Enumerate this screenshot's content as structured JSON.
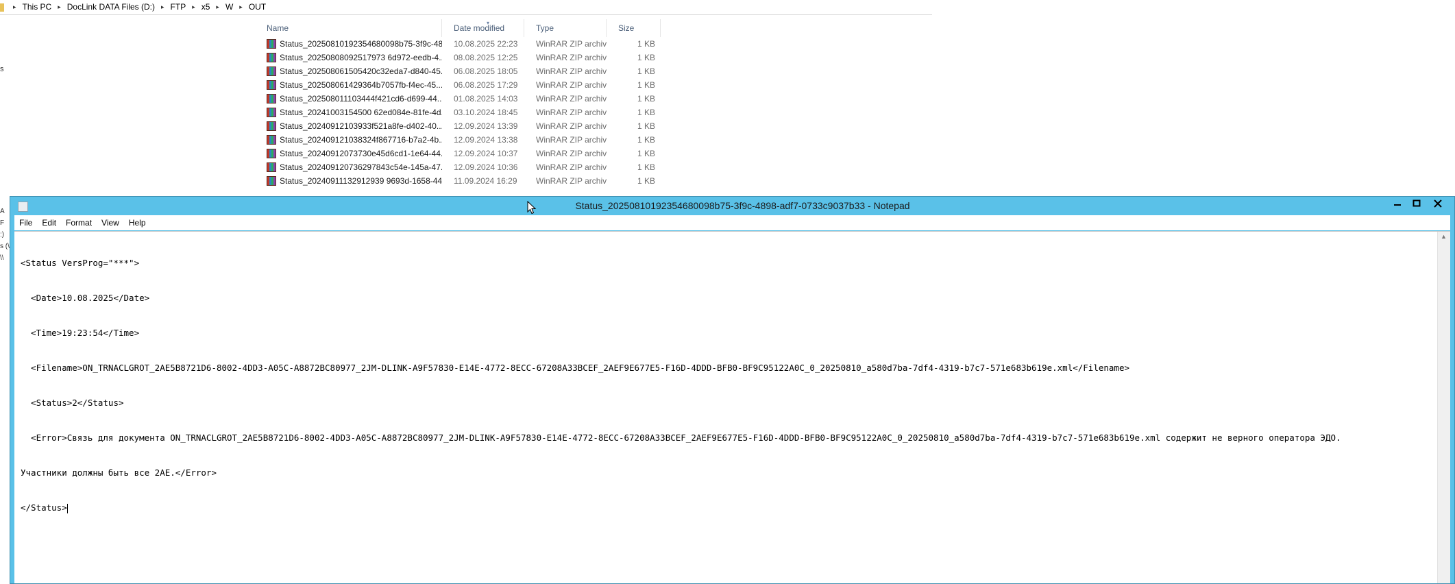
{
  "explorer": {
    "breadcrumb": [
      "This PC",
      "DocLink DATA Files (D:)",
      "FTP",
      "x5",
      "W",
      "OUT"
    ],
    "left_stub_text": "s",
    "left_stub_lines": [
      "A F",
      ":)",
      "s (\\",
      "\\\\"
    ],
    "columns": {
      "name": "Name",
      "date": "Date modified",
      "type": "Type",
      "size": "Size"
    },
    "files": [
      {
        "name": "Status_20250810192354680098b75-3f9c-48...",
        "date": "10.08.2025 22:23",
        "type": "WinRAR ZIP archive",
        "size": "1 KB"
      },
      {
        "name": "Status_20250808092517973 6d972-eedb-4...",
        "date": "08.08.2025 12:25",
        "type": "WinRAR ZIP archive",
        "size": "1 KB"
      },
      {
        "name": "Status_202508061505420c32eda7-d840-45...",
        "date": "06.08.2025 18:05",
        "type": "WinRAR ZIP archive",
        "size": "1 KB"
      },
      {
        "name": "Status_202508061429364b7057fb-f4ec-45...",
        "date": "06.08.2025 17:29",
        "type": "WinRAR ZIP archive",
        "size": "1 KB"
      },
      {
        "name": "Status_202508011103444f421cd6-d699-44...",
        "date": "01.08.2025 14:03",
        "type": "WinRAR ZIP archive",
        "size": "1 KB"
      },
      {
        "name": "Status_20241003154500 62ed084e-81fe-4d...",
        "date": "03.10.2024 18:45",
        "type": "WinRAR ZIP archive",
        "size": "1 KB"
      },
      {
        "name": "Status_20240912103933f521a8fe-d402-40...",
        "date": "12.09.2024 13:39",
        "type": "WinRAR ZIP archive",
        "size": "1 KB"
      },
      {
        "name": "Status_202409121038324f867716-b7a2-4b...",
        "date": "12.09.2024 13:38",
        "type": "WinRAR ZIP archive",
        "size": "1 KB"
      },
      {
        "name": "Status_20240912073730e45d6cd1-1e64-44...",
        "date": "12.09.2024 10:37",
        "type": "WinRAR ZIP archive",
        "size": "1 KB"
      },
      {
        "name": "Status_202409120736297843c54e-145a-47...",
        "date": "12.09.2024 10:36",
        "type": "WinRAR ZIP archive",
        "size": "1 KB"
      },
      {
        "name": "Status_20240911132912939 9693d-1658-44...",
        "date": "11.09.2024 16:29",
        "type": "WinRAR ZIP archive",
        "size": "1 KB"
      }
    ]
  },
  "notepad": {
    "title": "Status_20250810192354680098b75-3f9c-4898-adf7-0733c9037b33 - Notepad",
    "menu": [
      "File",
      "Edit",
      "Format",
      "View",
      "Help"
    ],
    "lines": [
      "<Status VersProg=\"***\">",
      "  <Date>10.08.2025</Date>",
      "  <Time>19:23:54</Time>",
      "  <Filename>ON_TRNACLGROT_2AE5B8721D6-8002-4DD3-A05C-A8872BC80977_2JM-DLINK-A9F57830-E14E-4772-8ECC-67208A33BCEF_2AEF9E677E5-F16D-4DDD-BFB0-BF9C95122A0C_0_20250810_a580d7ba-7df4-4319-b7c7-571e683b619e.xml</Filename>",
      "  <Status>2</Status>",
      "  <Error>Связь для документа ON_TRNACLGROT_2AE5B8721D6-8002-4DD3-A05C-A8872BC80977_2JM-DLINK-A9F57830-E14E-4772-8ECC-67208A33BCEF_2AEF9E677E5-F16D-4DDD-BFB0-BF9C95122A0C_0_20250810_a580d7ba-7df4-4319-b7c7-571e683b619e.xml содержит не верного оператора ЭДО.",
      "Участники должны быть все 2AE.</Error>",
      "</Status>"
    ],
    "colors": {
      "titlebar": "#5ac1e8",
      "close_button": "#000000"
    }
  }
}
